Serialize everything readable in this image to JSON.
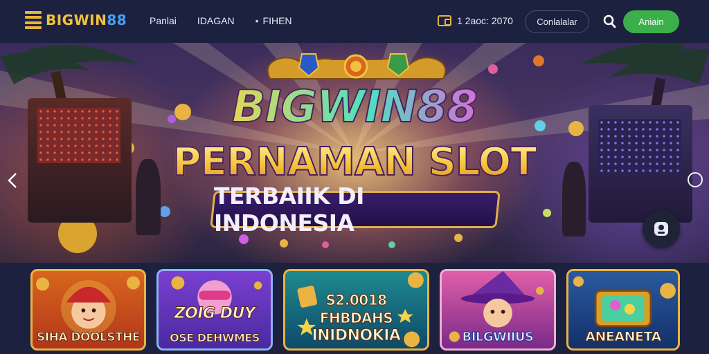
{
  "header": {
    "logo_part1": "BIGWIN",
    "logo_part2": "88",
    "nav": [
      "Panlai",
      "IDAGAN",
      "FIHEN"
    ],
    "balance": "1 2aoc: 2070",
    "login_label": "Conlalalar",
    "register_label": "Aniain"
  },
  "hero": {
    "line1": "BIGWIN88",
    "line2": "PERNAMAN SLOT",
    "line3": "TERBAIIK DI INDONESIA"
  },
  "games": [
    {
      "label": "SIHA DOOLSTHE"
    },
    {
      "label_top": "ZOIG DUY",
      "label": "OSE DEHWMES"
    },
    {
      "label_top": "S2.0018",
      "label_mid": "FHBDAHS",
      "label": "INIDNOKIA"
    },
    {
      "label": "BILGWIIUS"
    },
    {
      "label": "ANEANETA"
    }
  ],
  "colors": {
    "header_bg": "#1c2140",
    "accent_gold": "#e9b443",
    "register_green": "#3bb04a",
    "logo_blue": "#4aa0f0"
  },
  "icons": [
    "wallet-icon",
    "search-icon",
    "chat-icon",
    "arrow-left-icon",
    "arrow-right-icon"
  ]
}
